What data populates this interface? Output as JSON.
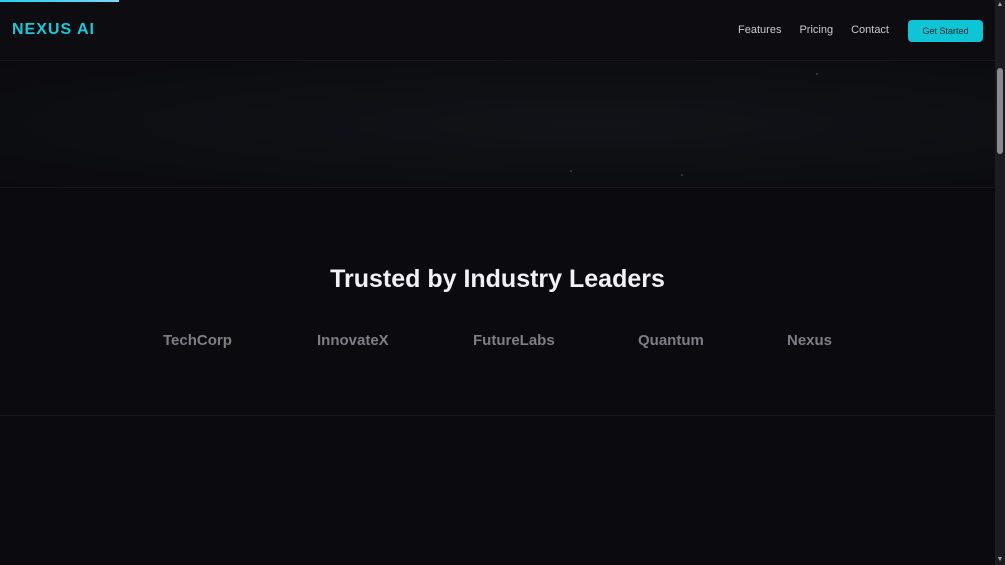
{
  "page": {
    "scroll_progress_percent": 12
  },
  "header": {
    "logo": "NEXUS AI",
    "nav": [
      {
        "label": "Features"
      },
      {
        "label": "Pricing"
      },
      {
        "label": "Contact"
      }
    ],
    "cta_label": "Get Started"
  },
  "trusted": {
    "heading": "Trusted by Industry Leaders",
    "partners": [
      {
        "name": "TechCorp"
      },
      {
        "name": "InnovateX"
      },
      {
        "name": "FutureLabs"
      },
      {
        "name": "Quantum"
      },
      {
        "name": "Nexus"
      }
    ]
  },
  "scrollbar": {
    "up_icon": "triangle-up-icon",
    "down_icon": "triangle-down-icon"
  },
  "colors": {
    "accent": "#0fc4d4",
    "logo": "#1cc8d8",
    "background": "#0b0b0f",
    "heading": "#f2f2f4",
    "partner_text": "#7d7d86"
  }
}
